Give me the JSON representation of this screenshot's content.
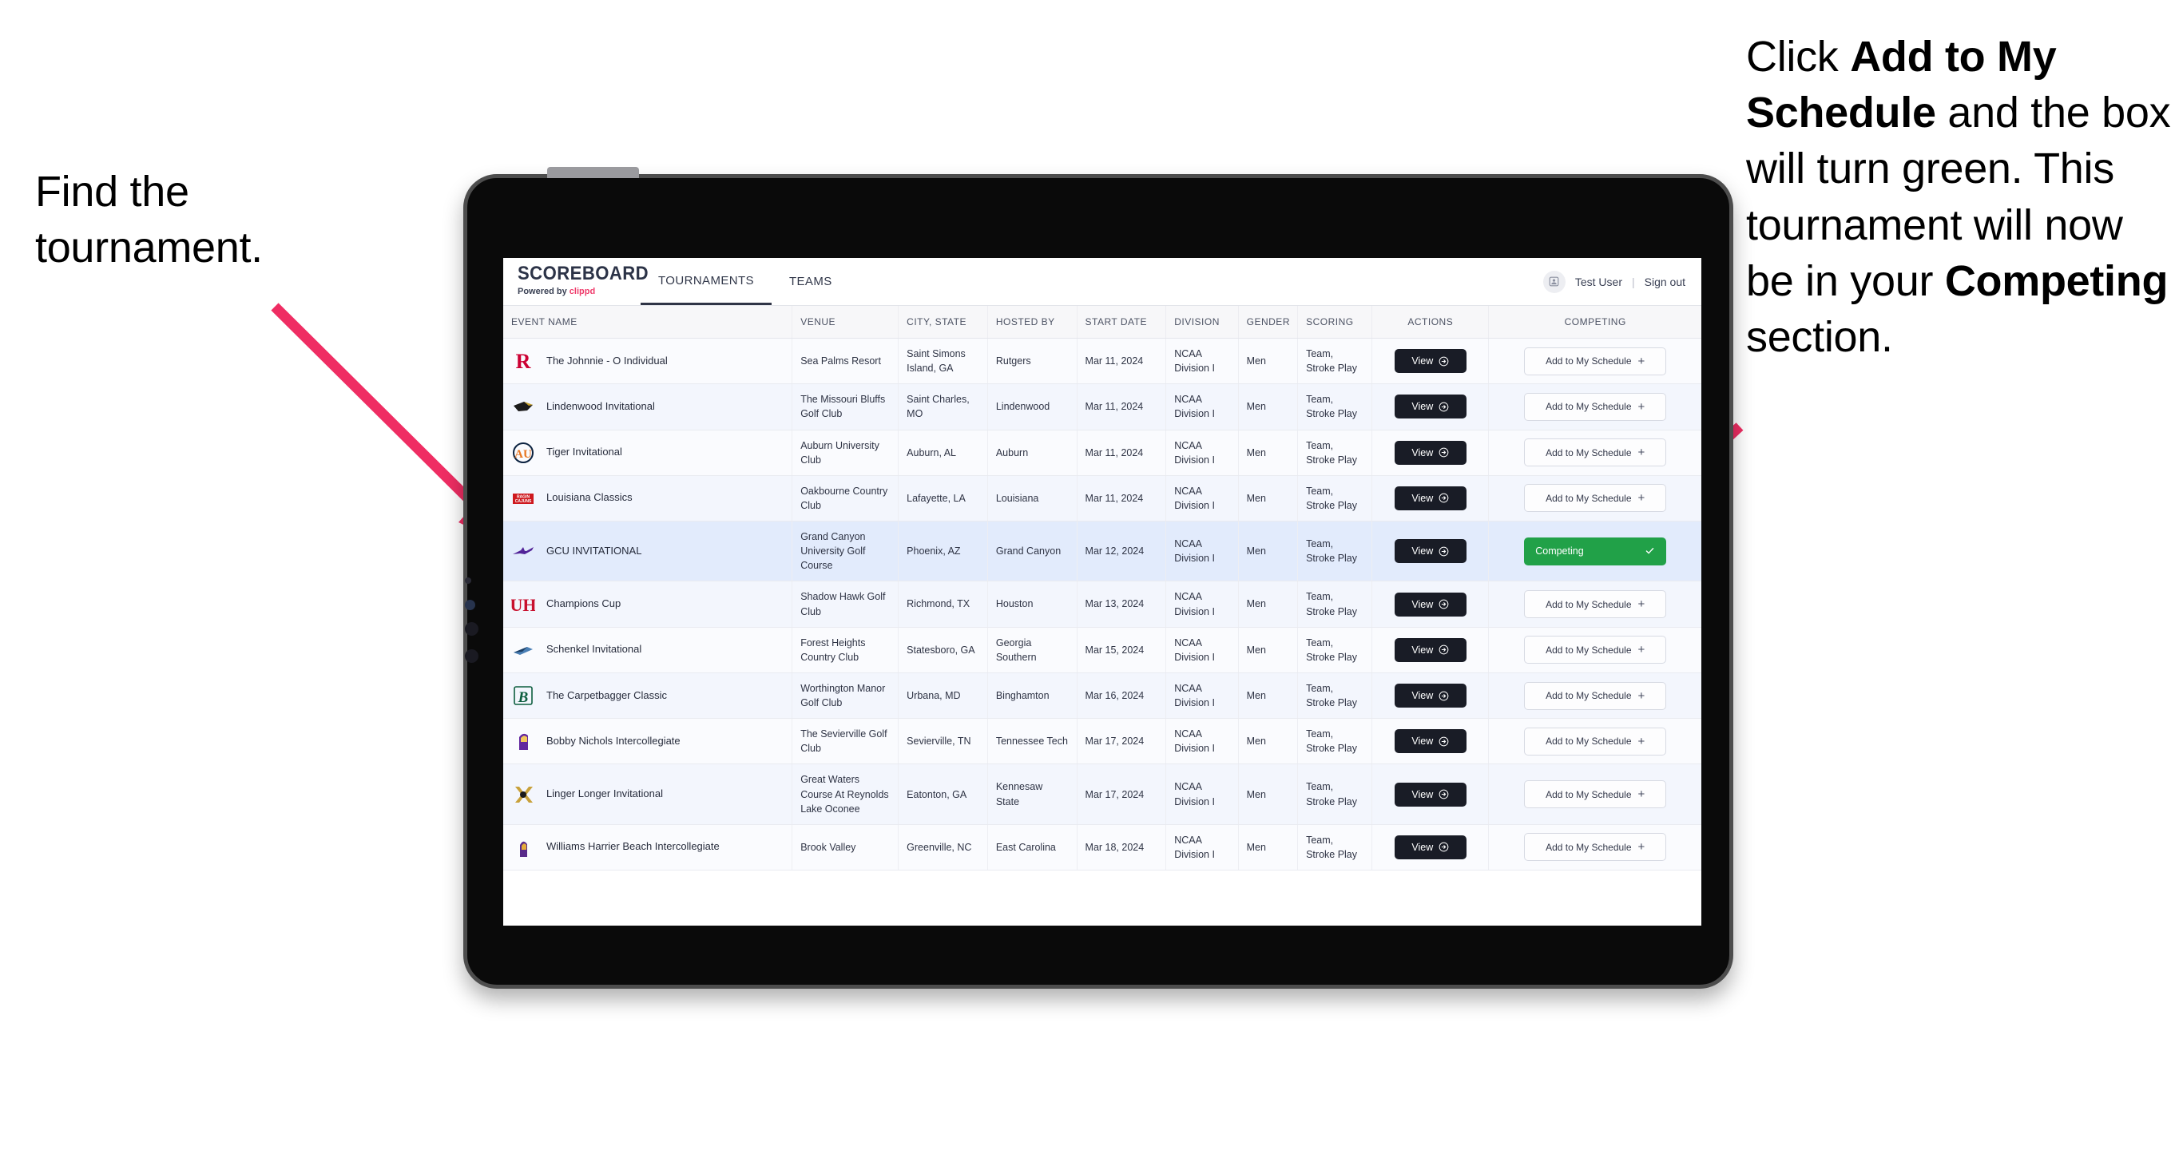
{
  "annotations": {
    "left": {
      "line1": "Find the",
      "line2": "tournament."
    },
    "right": {
      "seg1": "Click ",
      "bold1": "Add to My Schedule",
      "seg2": " and the box will turn green. This tournament will now be in your ",
      "bold2": "Competing",
      "seg3": " section."
    }
  },
  "app": {
    "brand": {
      "title": "SCOREBOARD",
      "powered_prefix": "Powered by ",
      "powered_name": "clippd"
    },
    "nav": [
      {
        "label": "TOURNAMENTS",
        "active": true
      },
      {
        "label": "TEAMS",
        "active": false
      }
    ],
    "user": {
      "avatar_icon": "user-avatar-icon",
      "name": "Test User",
      "separator": "|",
      "signout": "Sign out"
    }
  },
  "table": {
    "columns": [
      "EVENT NAME",
      "VENUE",
      "CITY, STATE",
      "HOSTED BY",
      "START DATE",
      "DIVISION",
      "GENDER",
      "SCORING",
      "ACTIONS",
      "COMPETING"
    ],
    "action_label": "View",
    "add_label": "Add to My Schedule",
    "add_icon": "plus-icon",
    "competing_label": "Competing",
    "competing_icon": "check-icon",
    "view_icon": "arrow-circle-right-icon",
    "rows": [
      {
        "logo": "rutgers-logo",
        "event": "The Johnnie - O Individual",
        "venue": "Sea Palms Resort",
        "city": "Saint Simons Island, GA",
        "hosted_by": "Rutgers",
        "start_date": "Mar 11, 2024",
        "division": "NCAA Division I",
        "gender": "Men",
        "scoring": "Team, Stroke Play",
        "competing": false,
        "selected": false
      },
      {
        "logo": "lindenwood-logo",
        "event": "Lindenwood Invitational",
        "venue": "The Missouri Bluffs Golf Club",
        "city": "Saint Charles, MO",
        "hosted_by": "Lindenwood",
        "start_date": "Mar 11, 2024",
        "division": "NCAA Division I",
        "gender": "Men",
        "scoring": "Team, Stroke Play",
        "competing": false,
        "selected": false
      },
      {
        "logo": "auburn-logo",
        "event": "Tiger Invitational",
        "venue": "Auburn University Club",
        "city": "Auburn, AL",
        "hosted_by": "Auburn",
        "start_date": "Mar 11, 2024",
        "division": "NCAA Division I",
        "gender": "Men",
        "scoring": "Team, Stroke Play",
        "competing": false,
        "selected": false
      },
      {
        "logo": "louisiana-logo",
        "event": "Louisiana Classics",
        "venue": "Oakbourne Country Club",
        "city": "Lafayette, LA",
        "hosted_by": "Louisiana",
        "start_date": "Mar 11, 2024",
        "division": "NCAA Division I",
        "gender": "Men",
        "scoring": "Team, Stroke Play",
        "competing": false,
        "selected": false
      },
      {
        "logo": "gcu-logo",
        "event": "GCU INVITATIONAL",
        "venue": "Grand Canyon University Golf Course",
        "city": "Phoenix, AZ",
        "hosted_by": "Grand Canyon",
        "start_date": "Mar 12, 2024",
        "division": "NCAA Division I",
        "gender": "Men",
        "scoring": "Team, Stroke Play",
        "competing": true,
        "selected": true
      },
      {
        "logo": "houston-logo",
        "event": "Champions Cup",
        "venue": "Shadow Hawk Golf Club",
        "city": "Richmond, TX",
        "hosted_by": "Houston",
        "start_date": "Mar 13, 2024",
        "division": "NCAA Division I",
        "gender": "Men",
        "scoring": "Team, Stroke Play",
        "competing": false,
        "selected": false
      },
      {
        "logo": "georgia-southern-logo",
        "event": "Schenkel Invitational",
        "venue": "Forest Heights Country Club",
        "city": "Statesboro, GA",
        "hosted_by": "Georgia Southern",
        "start_date": "Mar 15, 2024",
        "division": "NCAA Division I",
        "gender": "Men",
        "scoring": "Team, Stroke Play",
        "competing": false,
        "selected": false
      },
      {
        "logo": "binghamton-logo",
        "event": "The Carpetbagger Classic",
        "venue": "Worthington Manor Golf Club",
        "city": "Urbana, MD",
        "hosted_by": "Binghamton",
        "start_date": "Mar 16, 2024",
        "division": "NCAA Division I",
        "gender": "Men",
        "scoring": "Team, Stroke Play",
        "competing": false,
        "selected": false
      },
      {
        "logo": "tennessee-tech-logo",
        "event": "Bobby Nichols Intercollegiate",
        "venue": "The Sevierville Golf Club",
        "city": "Sevierville, TN",
        "hosted_by": "Tennessee Tech",
        "start_date": "Mar 17, 2024",
        "division": "NCAA Division I",
        "gender": "Men",
        "scoring": "Team, Stroke Play",
        "competing": false,
        "selected": false
      },
      {
        "logo": "kennesaw-state-logo",
        "event": "Linger Longer Invitational",
        "venue": "Great Waters Course At Reynolds Lake Oconee",
        "city": "Eatonton, GA",
        "hosted_by": "Kennesaw State",
        "start_date": "Mar 17, 2024",
        "division": "NCAA Division I",
        "gender": "Men",
        "scoring": "Team, Stroke Play",
        "competing": false,
        "selected": false
      },
      {
        "logo": "east-carolina-logo",
        "event": "Williams Harrier Beach Intercollegiate",
        "venue": "Brook Valley",
        "city": "Greenville, NC",
        "hosted_by": "East Carolina",
        "start_date": "Mar 18, 2024",
        "division": "NCAA Division I",
        "gender": "Men",
        "scoring": "Team, Stroke Play",
        "competing": false,
        "selected": false
      }
    ]
  },
  "colors": {
    "accent_pink": "#ef2d63",
    "brand_pink": "#ef3b6b",
    "competing_green": "#21a148",
    "view_dark": "#191c26",
    "selected_row": "#e2ebfc"
  }
}
